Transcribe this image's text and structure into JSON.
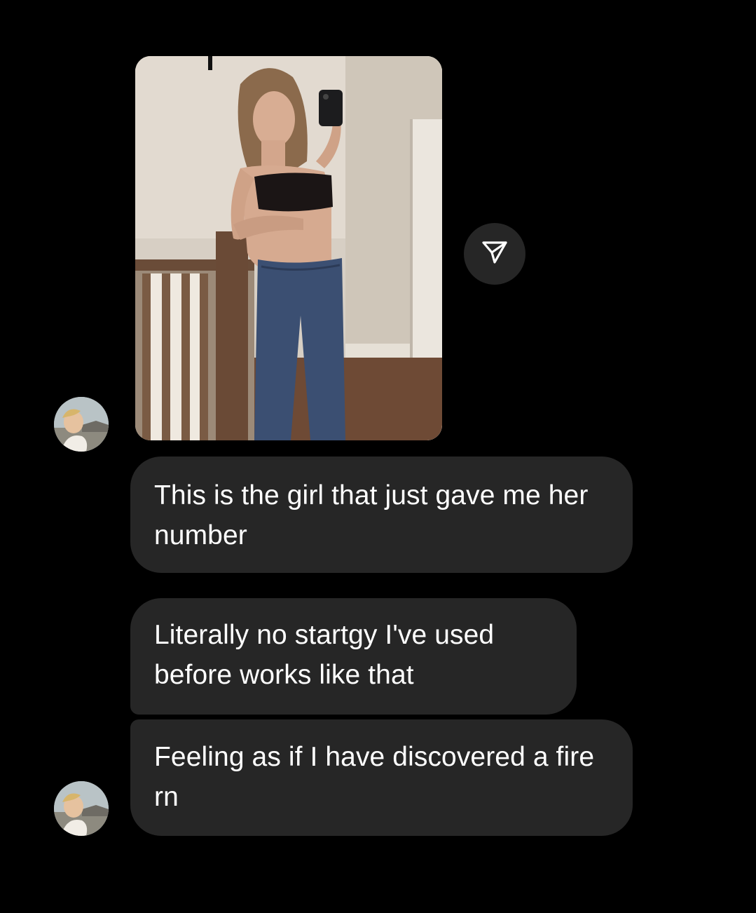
{
  "thread": {
    "shared_post": {
      "image_icon": "shared-photo",
      "share_icon": "paper-plane-icon"
    },
    "messages": [
      {
        "text": "This is the girl that just gave me her number"
      },
      {
        "text": "Literally no startgy I've used before works like that"
      },
      {
        "text": "Feeling as if I have discovered a fire rn"
      }
    ],
    "avatar_icon": "user-avatar-photo"
  },
  "colors": {
    "background": "#000000",
    "bubble": "#262626",
    "text": "#ffffff"
  }
}
